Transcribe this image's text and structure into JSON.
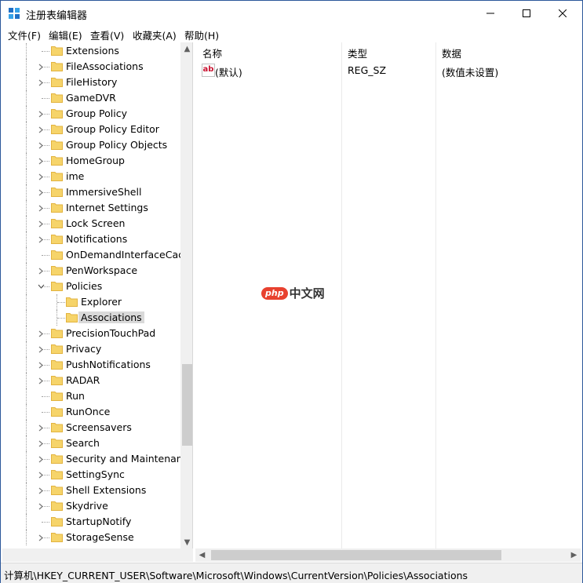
{
  "window": {
    "title": "注册表编辑器",
    "controls": {
      "minimize": "—",
      "maximize": "☐",
      "close": "✕"
    }
  },
  "menu": [
    "文件(F)",
    "编辑(E)",
    "查看(V)",
    "收藏夹(A)",
    "帮助(H)"
  ],
  "tree": {
    "items": [
      {
        "label": "Extensions",
        "expandable": false
      },
      {
        "label": "FileAssociations",
        "expandable": true
      },
      {
        "label": "FileHistory",
        "expandable": true
      },
      {
        "label": "GameDVR",
        "expandable": false
      },
      {
        "label": "Group Policy",
        "expandable": true
      },
      {
        "label": "Group Policy Editor",
        "expandable": true
      },
      {
        "label": "Group Policy Objects",
        "expandable": true
      },
      {
        "label": "HomeGroup",
        "expandable": true
      },
      {
        "label": "ime",
        "expandable": true
      },
      {
        "label": "ImmersiveShell",
        "expandable": true
      },
      {
        "label": "Internet Settings",
        "expandable": true
      },
      {
        "label": "Lock Screen",
        "expandable": true
      },
      {
        "label": "Notifications",
        "expandable": true
      },
      {
        "label": "OnDemandInterfaceCach",
        "expandable": false
      },
      {
        "label": "PenWorkspace",
        "expandable": true
      },
      {
        "label": "Policies",
        "expandable": true,
        "expanded": true
      },
      {
        "label": "Explorer",
        "expandable": false,
        "child": true
      },
      {
        "label": "Associations",
        "expandable": false,
        "child": true,
        "selected": true
      },
      {
        "label": "PrecisionTouchPad",
        "expandable": true
      },
      {
        "label": "Privacy",
        "expandable": true
      },
      {
        "label": "PushNotifications",
        "expandable": true
      },
      {
        "label": "RADAR",
        "expandable": true
      },
      {
        "label": "Run",
        "expandable": false
      },
      {
        "label": "RunOnce",
        "expandable": false
      },
      {
        "label": "Screensavers",
        "expandable": true
      },
      {
        "label": "Search",
        "expandable": true
      },
      {
        "label": "Security and Maintenanc",
        "expandable": true
      },
      {
        "label": "SettingSync",
        "expandable": true
      },
      {
        "label": "Shell Extensions",
        "expandable": true
      },
      {
        "label": "Skydrive",
        "expandable": true
      },
      {
        "label": "StartupNotify",
        "expandable": false
      },
      {
        "label": "StorageSense",
        "expandable": true
      }
    ]
  },
  "list": {
    "headers": {
      "name": "名称",
      "type": "类型",
      "data": "数据"
    },
    "rows": [
      {
        "icon": "string-value-icon",
        "icon_text": "ab",
        "name": "(默认)",
        "type": "REG_SZ",
        "data": "(数值未设置)"
      }
    ]
  },
  "status": {
    "path": "计算机\\HKEY_CURRENT_USER\\Software\\Microsoft\\Windows\\CurrentVersion\\Policies\\Associations"
  },
  "watermark": {
    "brand": "php",
    "text": "中文网"
  },
  "colors": {
    "folder": "#f6d46a",
    "folder_dark": "#e2b33f",
    "selection": "#d9d9d9",
    "watermark": "#e8412f"
  }
}
